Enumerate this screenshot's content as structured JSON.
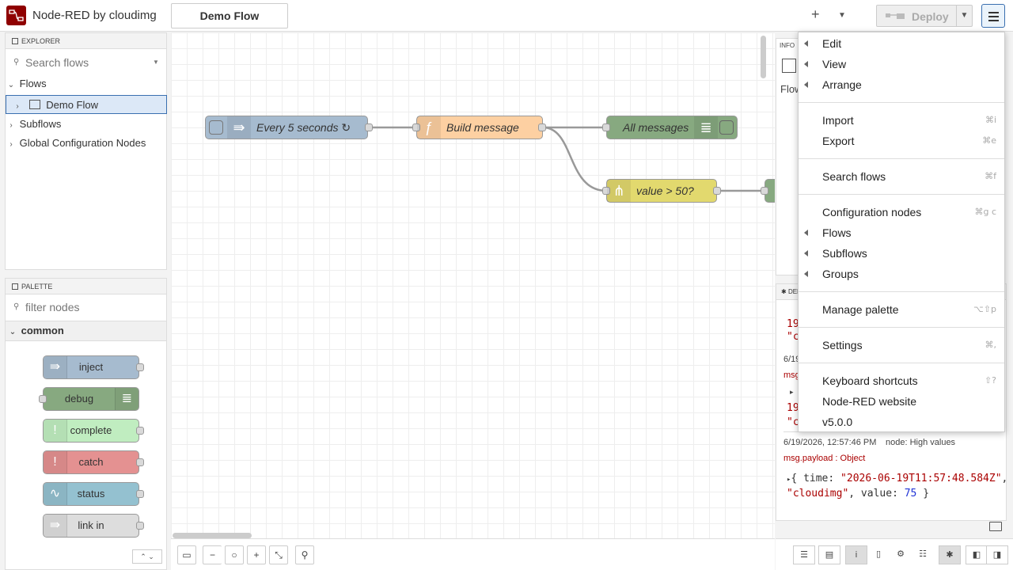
{
  "header": {
    "title": "Node-RED by cloudimg",
    "active_tab": "Demo Flow",
    "deploy_label": "Deploy"
  },
  "explorer": {
    "title": "EXPLORER",
    "search_placeholder": "Search flows",
    "tree": {
      "flows": "Flows",
      "demo_flow": "Demo Flow",
      "subflows": "Subflows",
      "global_config": "Global Configuration Nodes"
    }
  },
  "palette": {
    "title": "PALETTE",
    "filter_placeholder": "filter nodes",
    "category": "common",
    "nodes": [
      "inject",
      "debug",
      "complete",
      "catch",
      "status",
      "link in"
    ]
  },
  "workspace": {
    "nodes": {
      "inject": "Every 5 seconds ↻",
      "function": "Build message",
      "debug": "All messages",
      "switch": "value > 50?"
    }
  },
  "info_panel": {
    "title": "INFO",
    "flow_label": "Flow"
  },
  "debug_panel": {
    "title": "DEBUG",
    "partial": {
      "a": "19",
      "b": "\"c",
      "date": "6/19/",
      "msg": "msg.",
      "c": "19",
      "d": "\"c"
    },
    "entry": {
      "timestamp": "6/19/2026, 12:57:46 PM",
      "node": "node: High values",
      "payload_label": "msg.payload : Object",
      "time_value": "\"2026-06-19T11:57:48.584Z\"",
      "source_value": "\"cloudimg\"",
      "value_value": "75"
    }
  },
  "menu": {
    "items": [
      {
        "label": "Edit",
        "sub": true
      },
      {
        "label": "View",
        "sub": true
      },
      {
        "label": "Arrange",
        "sub": true
      },
      {
        "label": "Import",
        "key": "⌘i"
      },
      {
        "label": "Export",
        "key": "⌘e"
      },
      {
        "label": "Search flows",
        "key": "⌘f"
      },
      {
        "label": "Configuration nodes",
        "key": "⌘g c"
      },
      {
        "label": "Flows",
        "sub": true
      },
      {
        "label": "Subflows",
        "sub": true
      },
      {
        "label": "Groups",
        "sub": true
      },
      {
        "label": "Manage palette",
        "key": "⌥⇧p"
      },
      {
        "label": "Settings",
        "key": "⌘,"
      },
      {
        "label": "Keyboard shortcuts",
        "key": "⇧?"
      },
      {
        "label": "Node-RED website"
      },
      {
        "label": "v5.0.0"
      }
    ]
  },
  "colors": {
    "inject": "#a6bbcf",
    "function": "#fdd0a2",
    "debug": "#87a980",
    "switch": "#e2d96e",
    "complete": "#c0edc0",
    "catch": "#e49191",
    "status": "#94c1d0",
    "link": "#dddddd",
    "selection": "#3a6fb0"
  }
}
